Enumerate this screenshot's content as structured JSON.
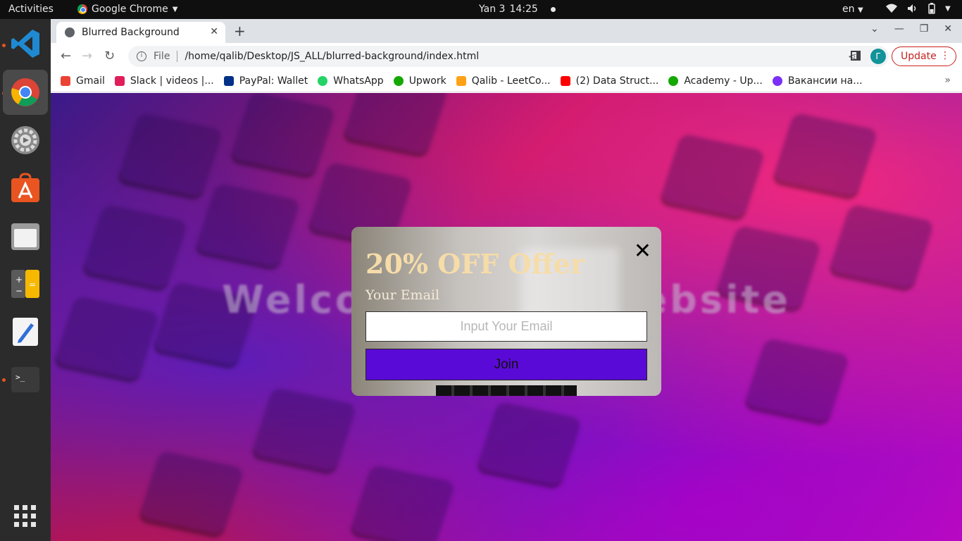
{
  "topbar": {
    "activities": "Activities",
    "app_name": "Google Chrome",
    "date": "Yan 3",
    "time": "14:25",
    "lang": "en"
  },
  "dock": {
    "items": [
      "vscode-icon",
      "chrome-icon",
      "settings-icon",
      "software-icon",
      "files-icon",
      "calculator-icon",
      "text-editor-icon",
      "terminal-icon",
      "app-grid-icon"
    ]
  },
  "browser": {
    "tab_title": "Blurred Background",
    "omnibox_scheme": "File",
    "url": "/home/qalib/Desktop/JS_ALL/blurred-background/index.html",
    "profile_initial": "Г",
    "update_label": "Update",
    "bookmarks": [
      {
        "label": "Gmail",
        "color": "#ea4335"
      },
      {
        "label": "Slack | videos |...",
        "color": "#e01e5a"
      },
      {
        "label": "PayPal: Wallet",
        "color": "#003087"
      },
      {
        "label": "WhatsApp",
        "color": "#25d366"
      },
      {
        "label": "Upwork",
        "color": "#14a800"
      },
      {
        "label": "Qalib - LeetCo...",
        "color": "#ffa116"
      },
      {
        "label": "(2) Data Struct...",
        "color": "#ff0000"
      },
      {
        "label": "Academy - Up...",
        "color": "#14a800"
      },
      {
        "label": "Вакансии на...",
        "color": "#7b2ff7"
      }
    ]
  },
  "page": {
    "welcome_text": "Welcome to my website",
    "popup": {
      "title": "20% OFF Offer",
      "close_glyph": "✕",
      "email_label": "Your Email",
      "email_placeholder": "Input Your Email",
      "email_value": "",
      "join_label": "Join"
    }
  }
}
